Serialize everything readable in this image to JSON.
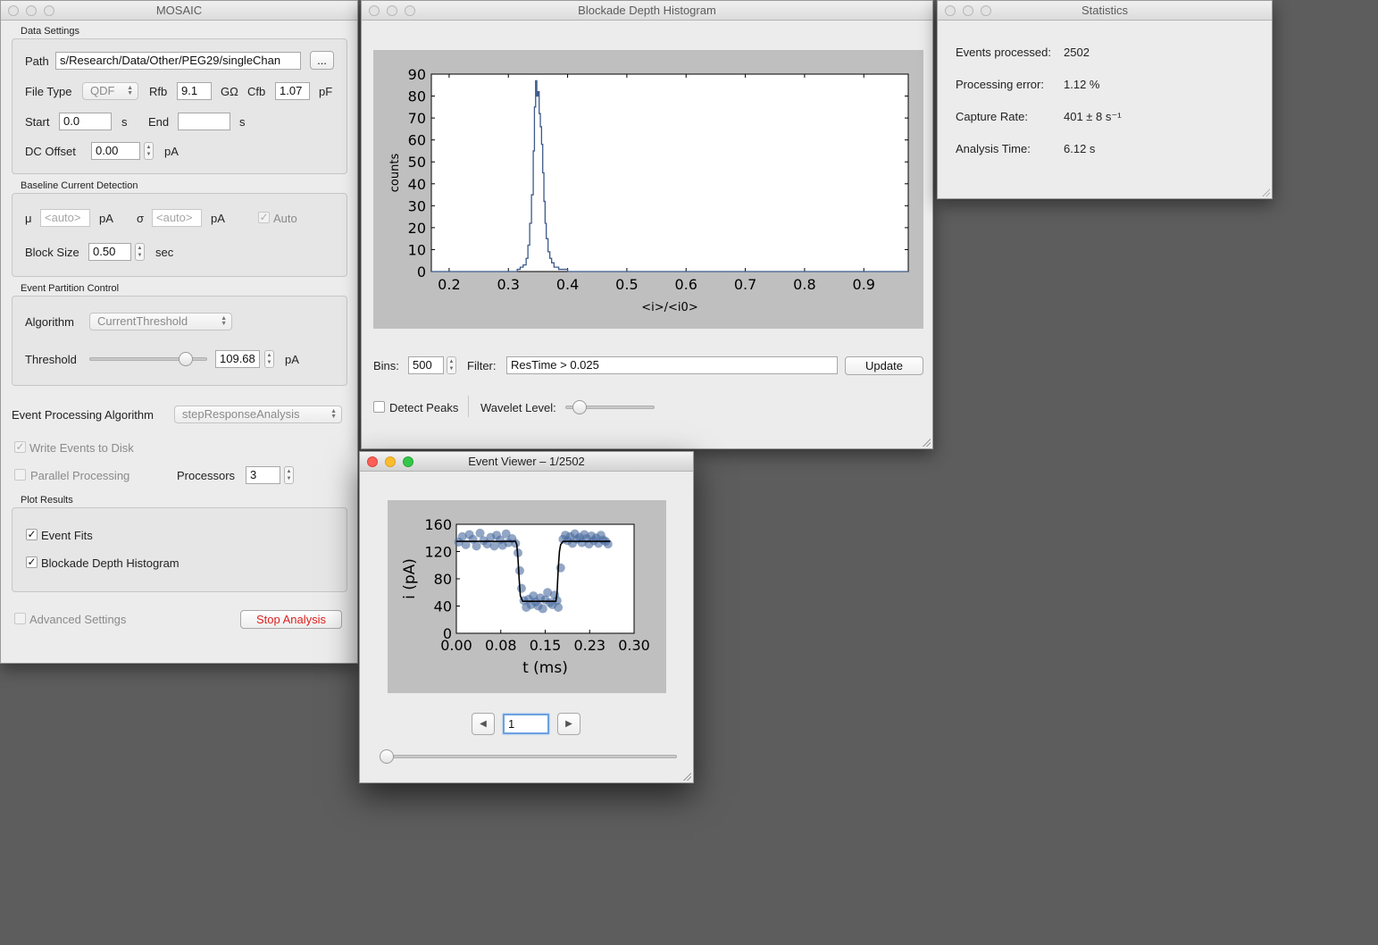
{
  "mosaic": {
    "title": "MOSAIC",
    "data_settings": {
      "group_title": "Data Settings",
      "path_label": "Path",
      "path_value": "s/Research/Data/Other/PEG29/singleChan",
      "browse_label": "...",
      "filetype_label": "File Type",
      "filetype_value": "QDF",
      "rfb_label": "Rfb",
      "rfb_value": "9.1",
      "rfb_unit": "GΩ",
      "cfb_label": "Cfb",
      "cfb_value": "1.07",
      "cfb_unit": "pF",
      "start_label": "Start",
      "start_value": "0.0",
      "start_unit": "s",
      "end_label": "End",
      "end_value": "",
      "end_unit": "s",
      "dcoffset_label": "DC Offset",
      "dcoffset_value": "0.00",
      "dcoffset_unit": "pA"
    },
    "baseline": {
      "group_title": "Baseline Current Detection",
      "mu_label": "μ",
      "mu_placeholder": "<auto>",
      "mu_unit": "pA",
      "sigma_label": "σ",
      "sigma_placeholder": "<auto>",
      "sigma_unit": "pA",
      "auto_label": "Auto",
      "auto_checked": true,
      "blocksize_label": "Block Size",
      "blocksize_value": "0.50",
      "blocksize_unit": "sec"
    },
    "partition": {
      "group_title": "Event Partition Control",
      "algorithm_label": "Algorithm",
      "algorithm_value": "CurrentThreshold",
      "threshold_label": "Threshold",
      "threshold_value": "109.68",
      "threshold_unit": "pA",
      "threshold_slider_fraction": 0.86
    },
    "processing": {
      "label": "Event Processing Algorithm",
      "value": "stepResponseAnalysis",
      "write_events_label": "Write Events to Disk",
      "write_events_checked": true,
      "parallel_label": "Parallel Processing",
      "parallel_checked": false,
      "processors_label": "Processors",
      "processors_value": "3"
    },
    "plot_results": {
      "group_title": "Plot Results",
      "event_fits_label": "Event Fits",
      "event_fits_checked": true,
      "histogram_label": "Blockade Depth Histogram",
      "histogram_checked": true
    },
    "advanced_label": "Advanced Settings",
    "stop_label": "Stop Analysis",
    "stop_color": "#e02020"
  },
  "histogram_window": {
    "title": "Blockade Depth Histogram",
    "bins_label": "Bins:",
    "bins_value": "500",
    "filter_label": "Filter:",
    "filter_value": "ResTime > 0.025",
    "update_label": "Update",
    "detect_peaks_label": "Detect Peaks",
    "detect_peaks_checked": false,
    "wavelet_label": "Wavelet Level:",
    "wavelet_slider_fraction": 0.1
  },
  "statistics": {
    "title": "Statistics",
    "rows": [
      {
        "label": "Events processed:",
        "value": "2502"
      },
      {
        "label": "Processing error:",
        "value": "1.12 %"
      },
      {
        "label": "Capture Rate:",
        "value": "401 ± 8 s⁻¹"
      },
      {
        "label": "Analysis Time:",
        "value": "6.12 s"
      }
    ]
  },
  "event_viewer": {
    "title": "Event Viewer – 1/2502",
    "prev_icon": "◀",
    "next_icon": "▶",
    "event_index": "1",
    "slider_fraction": 0.0
  },
  "chart_data": [
    {
      "type": "line",
      "title": "",
      "xlabel": "<i>/<i0>",
      "ylabel": "counts",
      "xlim": [
        0.17,
        0.975
      ],
      "ylim": [
        0,
        90
      ],
      "xticks": [
        0.2,
        0.3,
        0.4,
        0.5,
        0.6,
        0.7,
        0.8,
        0.9
      ],
      "yticks": [
        0,
        10,
        20,
        30,
        40,
        50,
        60,
        70,
        80,
        90
      ],
      "color": "#3d5a8a",
      "x": [
        0.17,
        0.31,
        0.315,
        0.32,
        0.325,
        0.33,
        0.333,
        0.336,
        0.339,
        0.342,
        0.344,
        0.346,
        0.348,
        0.35,
        0.352,
        0.354,
        0.356,
        0.358,
        0.36,
        0.362,
        0.364,
        0.367,
        0.37,
        0.373,
        0.377,
        0.381,
        0.385,
        0.39,
        0.4,
        0.45,
        0.975
      ],
      "y": [
        0,
        0,
        1,
        2,
        3,
        6,
        12,
        22,
        35,
        55,
        75,
        87,
        80,
        82,
        72,
        66,
        58,
        45,
        32,
        22,
        15,
        9,
        6,
        4,
        2,
        2,
        1,
        1,
        0,
        0,
        0
      ]
    },
    {
      "type": "scatter",
      "title": "",
      "xlabel": "t (ms)",
      "ylabel": "i (pA)",
      "xlim": [
        0.0,
        0.3
      ],
      "ylim": [
        0,
        160
      ],
      "xtick_values": [
        0.0,
        0.075,
        0.15,
        0.225,
        0.3
      ],
      "xtick_labels": [
        "0.00",
        "0.08",
        "0.15",
        "0.23",
        "0.30"
      ],
      "yticks": [
        0,
        40,
        80,
        120,
        160
      ],
      "point_color": "#4a6a9e",
      "series": [
        {
          "name": "data",
          "x": [
            0.004,
            0.01,
            0.016,
            0.022,
            0.028,
            0.034,
            0.04,
            0.046,
            0.052,
            0.058,
            0.064,
            0.068,
            0.074,
            0.078,
            0.084,
            0.088,
            0.094,
            0.1,
            0.104,
            0.107,
            0.11,
            0.114,
            0.118,
            0.122,
            0.126,
            0.13,
            0.134,
            0.138,
            0.142,
            0.146,
            0.15,
            0.154,
            0.158,
            0.162,
            0.166,
            0.17,
            0.172,
            0.176,
            0.18,
            0.184,
            0.188,
            0.192,
            0.196,
            0.2,
            0.204,
            0.208,
            0.212,
            0.216,
            0.22,
            0.224,
            0.228,
            0.232,
            0.236,
            0.24,
            0.244,
            0.248,
            0.252,
            0.256
          ],
          "y": [
            134,
            142,
            130,
            145,
            138,
            128,
            147,
            136,
            131,
            141,
            128,
            144,
            137,
            129,
            146,
            133,
            139,
            132,
            118,
            92,
            66,
            48,
            38,
            50,
            42,
            55,
            46,
            40,
            52,
            36,
            49,
            60,
            45,
            42,
            56,
            48,
            38,
            96,
            138,
            144,
            136,
            142,
            132,
            146,
            138,
            141,
            133,
            145,
            139,
            131,
            143,
            136,
            140,
            132,
            144,
            137,
            135,
            131
          ]
        },
        {
          "name": "fit",
          "x": [
            0.0,
            0.1,
            0.102,
            0.104,
            0.106,
            0.108,
            0.112,
            0.168,
            0.17,
            0.172,
            0.174,
            0.176,
            0.18,
            0.26
          ],
          "y": [
            135,
            135,
            130,
            110,
            80,
            55,
            47,
            47,
            60,
            95,
            120,
            130,
            135,
            135
          ]
        }
      ]
    }
  ]
}
